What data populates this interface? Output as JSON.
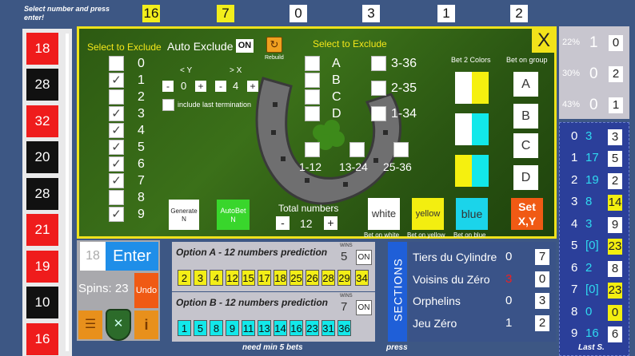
{
  "top": {
    "instruction": "Select number and press enter!",
    "numbers": [
      "16",
      "7",
      "0",
      "3",
      "1",
      "2"
    ]
  },
  "history": [
    "18",
    "28",
    "32",
    "20",
    "28",
    "21",
    "19",
    "10",
    "16"
  ],
  "panel": {
    "select_exclude_left": "Select to Exclude",
    "auto_exclude": "Auto Exclude",
    "on_label": "ON",
    "rebuild": "Rebuild",
    "select_exclude_mid": "Select to Exclude",
    "close": "X",
    "digits": [
      "0",
      "1",
      "2",
      "3",
      "4",
      "5",
      "6",
      "7",
      "8",
      "9"
    ],
    "y_label": "< Y",
    "x_label": "> X",
    "minus": "-",
    "plus": "+",
    "y_value": "0",
    "x_value": "4",
    "include_last": "include last termination",
    "letters": [
      "A",
      "B",
      "C",
      "D"
    ],
    "ranges": [
      "3-36",
      "2-35",
      "1-34"
    ],
    "dozens": [
      "1-12",
      "13-24",
      "25-36"
    ],
    "bet2colors": "Bet 2 Colors",
    "bet_group": "Bet on group",
    "groups": [
      "A",
      "B",
      "C",
      "D"
    ],
    "generate": "Generate N",
    "autobet": "AutoBet N",
    "total_numbers": "Total numbers",
    "total_value": "12",
    "white": "white",
    "yellow": "yellow",
    "blue": "blue",
    "set_xy": "Set X,Y",
    "bet_white": "Bet on white",
    "bet_yellow": "Bet on yellow",
    "bet_blue": "Bet on blue"
  },
  "right_top": [
    {
      "pct": "22%",
      "big": "1",
      "small": "0"
    },
    {
      "pct": "30%",
      "big": "0",
      "small": "2"
    },
    {
      "pct": "43%",
      "big": "0",
      "small": "1"
    }
  ],
  "right_list": [
    {
      "n": "0",
      "c": "3",
      "v": "3"
    },
    {
      "n": "1",
      "c": "17",
      "v": "5"
    },
    {
      "n": "2",
      "c": "19",
      "v": "2"
    },
    {
      "n": "3",
      "c": "8",
      "v": "14"
    },
    {
      "n": "4",
      "c": "3",
      "v": "9"
    },
    {
      "n": "5",
      "c": "[0]",
      "v": "23"
    },
    {
      "n": "6",
      "c": "2",
      "v": "8"
    },
    {
      "n": "7",
      "c": "[0]",
      "v": "23"
    },
    {
      "n": "8",
      "c": "0",
      "v": "0"
    },
    {
      "n": "9",
      "c": "16",
      "v": "6"
    }
  ],
  "input": {
    "value": "18",
    "enter": "Enter",
    "spins": "Spins: 23",
    "undo": "Undo"
  },
  "optA": {
    "title": "Option A - 12 numbers prediction",
    "wins_label": "WINS",
    "wins": "5",
    "on": "ON",
    "numbers": [
      "2",
      "3",
      "4",
      "12",
      "15",
      "17",
      "18",
      "25",
      "26",
      "28",
      "29",
      "34"
    ]
  },
  "optB": {
    "title": "Option B - 12 numbers prediction",
    "wins_label": "WINS",
    "wins": "7",
    "on": "ON",
    "numbers": [
      "1",
      "5",
      "8",
      "9",
      "11",
      "13",
      "14",
      "16",
      "23",
      "31",
      "36"
    ]
  },
  "sections": {
    "label": "SECTIONS",
    "rows": [
      {
        "name": "Tiers du Cylindre",
        "count": "0",
        "val": "7"
      },
      {
        "name": "Voisins du Zéro",
        "count": "3",
        "val": "0"
      },
      {
        "name": "Orphelins",
        "count": "0",
        "val": "3"
      },
      {
        "name": "Jeu Zéro",
        "count": "1",
        "val": "2"
      }
    ]
  },
  "footer": {
    "need_bets": "need min 5 bets",
    "press": "press",
    "last": "Last S."
  },
  "colors": {
    "accent_yellow": "#efe21b",
    "red": "#ef1c1c",
    "cyan": "#12e8ea",
    "blue_btn": "#1f8ee8",
    "orange": "#f05a14"
  }
}
